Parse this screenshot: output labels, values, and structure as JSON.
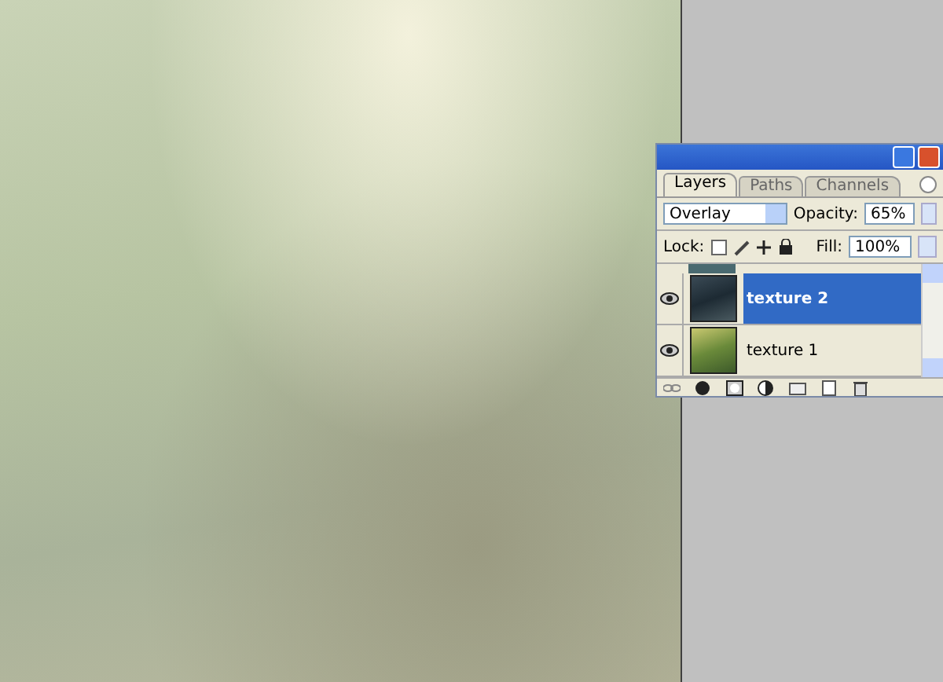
{
  "tabs": [
    {
      "label": "Layers",
      "selected": true
    },
    {
      "label": "Paths",
      "selected": false
    },
    {
      "label": "Channels",
      "selected": false
    }
  ],
  "blend_mode": "Overlay",
  "opacity_label": "Opacity:",
  "opacity": "65%",
  "lock_label": "Lock:",
  "fill_label": "Fill:",
  "fill": "100%",
  "layers": [
    {
      "name": "texture 2",
      "visible": true,
      "selected": true
    },
    {
      "name": "texture 1",
      "visible": true,
      "selected": false
    }
  ]
}
